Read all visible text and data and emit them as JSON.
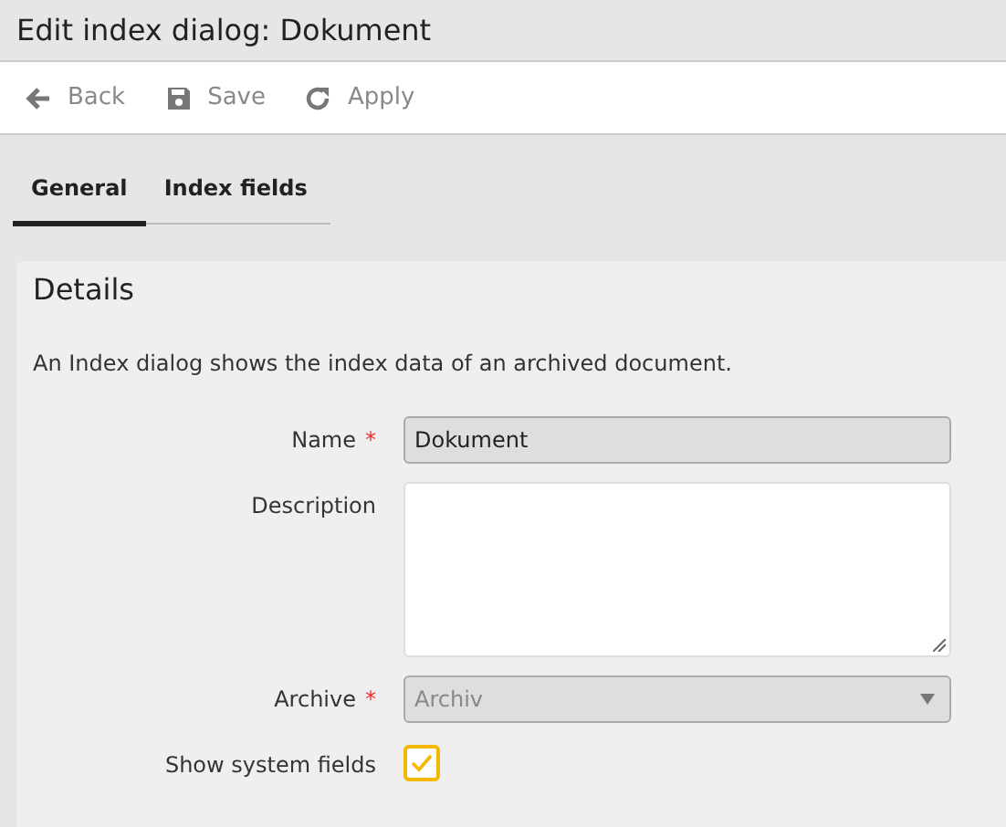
{
  "window": {
    "title": "Edit index dialog: Dokument"
  },
  "toolbar": [
    {
      "kind": "back",
      "label": "Back"
    },
    {
      "kind": "save",
      "label": "Save"
    },
    {
      "kind": "apply",
      "label": "Apply"
    }
  ],
  "tabs": [
    {
      "label": "General",
      "selected": true
    },
    {
      "label": "Index fields",
      "selected": false
    }
  ],
  "panel": {
    "title": "Details",
    "description": "An Index dialog shows the index data of an archived document."
  },
  "fields": [
    {
      "kind": "text",
      "label": "Name",
      "required_mark": "*",
      "value": "Dokument"
    },
    {
      "kind": "textarea",
      "label": "Description"
    },
    {
      "kind": "select",
      "label": "Archive",
      "required_mark": "*",
      "value": "Archiv"
    },
    {
      "kind": "checkbox",
      "label": "Show system fields",
      "checked": true
    }
  ]
}
